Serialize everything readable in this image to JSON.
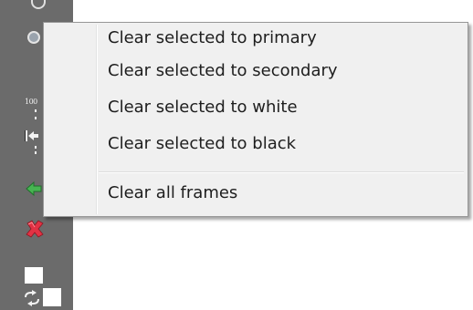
{
  "menu": {
    "items": [
      {
        "label": "Clear selected to primary"
      },
      {
        "label": "Clear selected to secondary"
      },
      {
        "label": "Clear selected to white"
      },
      {
        "label": "Clear selected to black"
      }
    ],
    "footer_items": [
      {
        "label": "Clear all frames"
      }
    ]
  },
  "toolbar": {
    "fps_label": "100",
    "primary_color": "#ffffff",
    "secondary_color": "#ffffff",
    "icons": [
      "knob-icon",
      "zoom-icon",
      "step-back-icon",
      "arrow-left-icon",
      "delete-x-icon",
      "swap-colors-icon"
    ]
  },
  "colors": {
    "toolbar_bg": "#6b6b6b",
    "menu_bg": "#f0f0f0",
    "menu_border": "#979797",
    "arrow_green": "#3aa64a",
    "delete_red": "#d8283a"
  }
}
